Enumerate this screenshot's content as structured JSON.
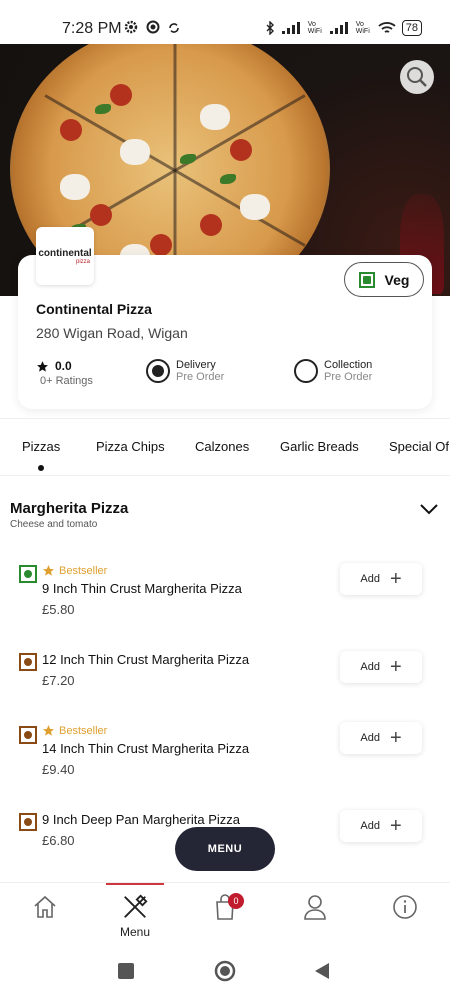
{
  "status_bar": {
    "time": "7:28 PM",
    "left_icons": [
      "settings-icon",
      "circle-icon",
      "sync-icon"
    ],
    "right_icons": [
      "bluetooth-icon",
      "signal-icon",
      "vowifi-icon",
      "signal-icon",
      "vowifi-icon",
      "wifi-icon"
    ],
    "vo_wifi_1": "Vo\nWiFi",
    "vo_wifi_2": "Vo\nWiFi",
    "battery": "78"
  },
  "restaurant": {
    "logo_text": "continental",
    "logo_sub": "pizza",
    "name": "Continental Pizza",
    "address": "280 Wigan Road, Wigan",
    "veg_toggle_label": "Veg",
    "rating_value": "0.0",
    "rating_count": "0+ Ratings",
    "delivery": {
      "title": "Delivery",
      "sub": "Pre Order",
      "selected": true
    },
    "collection": {
      "title": "Collection",
      "sub": "Pre Order",
      "selected": false
    }
  },
  "tabs": [
    {
      "label": "Pizzas",
      "active": true
    },
    {
      "label": "Pizza Chips",
      "active": false
    },
    {
      "label": "Calzones",
      "active": false
    },
    {
      "label": "Garlic Breads",
      "active": false
    },
    {
      "label": "Special Of",
      "active": false
    }
  ],
  "section": {
    "title": "Margherita Pizza",
    "subtitle": "Cheese and tomato"
  },
  "items": [
    {
      "name": "9 Inch Thin Crust Margherita Pizza",
      "price": "£5.80",
      "bestseller": "Bestseller",
      "badge_color": "#2a8a2f",
      "add_label": "Add"
    },
    {
      "name": "12 Inch Thin Crust Margherita Pizza",
      "price": "£7.20",
      "bestseller": "",
      "badge_color": "#8a4a14",
      "add_label": "Add"
    },
    {
      "name": "14 Inch Thin Crust Margherita Pizza",
      "price": "£9.40",
      "bestseller": "Bestseller",
      "badge_color": "#8a4a14",
      "add_label": "Add"
    },
    {
      "name": "9 Inch Deep Pan Margherita Pizza",
      "price": "£6.80",
      "bestseller": "",
      "badge_color": "#8a4a14",
      "add_label": "Add"
    }
  ],
  "menu_fab_label": "MENU",
  "bottom_nav": {
    "home_icon": "home-icon",
    "menu_label": "Menu",
    "cart_count": "0",
    "profile_icon": "profile-icon",
    "info_icon": "info-icon",
    "active_accent": "#d0363d"
  },
  "colors": {
    "veg_green": "#2a8a2f",
    "nonveg_brown": "#8a4a14",
    "bestseller_orange": "#e0a030",
    "fab_dark": "#242636"
  }
}
